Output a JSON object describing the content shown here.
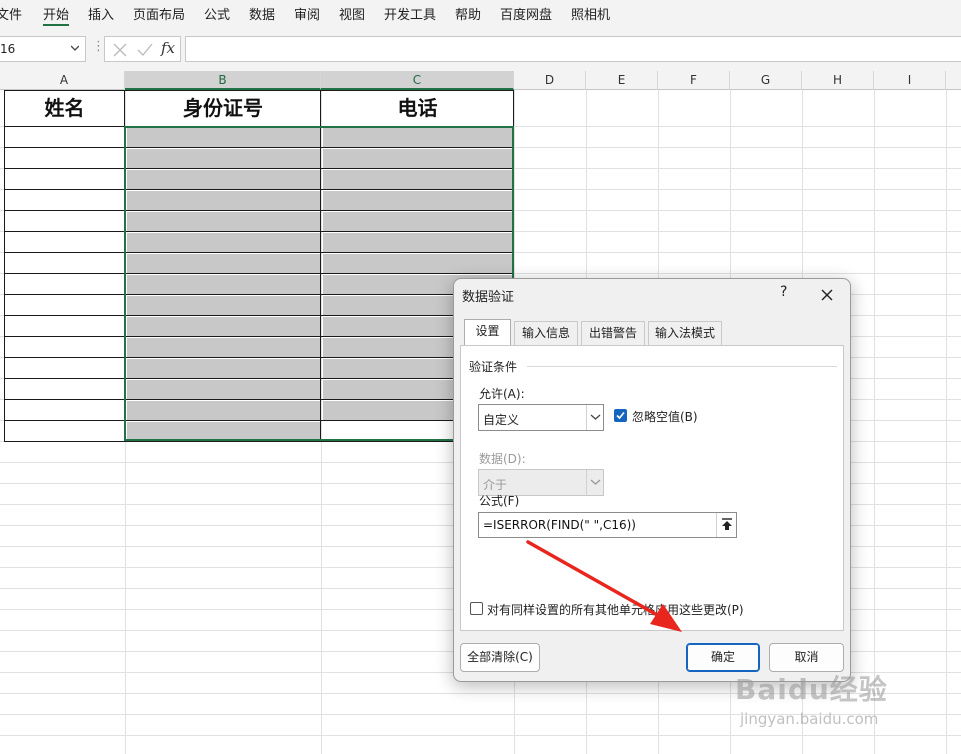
{
  "menu": [
    "文件",
    "开始",
    "插入",
    "页面布局",
    "公式",
    "数据",
    "审阅",
    "视图",
    "开发工具",
    "帮助",
    "百度网盘",
    "照相机"
  ],
  "active_menu": "开始",
  "name_box": "16",
  "formula_bar_symbols": {
    "fx": "fx"
  },
  "columns": [
    "A",
    "B",
    "C",
    "D",
    "E",
    "F",
    "G",
    "H",
    "I"
  ],
  "table": {
    "headers": [
      "姓名",
      "身份证号",
      "电话"
    ],
    "shade_color": "#c8c8c8",
    "selection_color": "#217346"
  },
  "dialog": {
    "title": "数据验证",
    "help": "?",
    "tabs": [
      "设置",
      "输入信息",
      "出错警告",
      "输入法模式"
    ],
    "active_tab": "设置",
    "group_label": "验证条件",
    "allow_label": "允许(A):",
    "allow_value": "自定义",
    "ignore_blank_label": "忽略空值(B)",
    "ignore_blank_checked": true,
    "data_label": "数据(D):",
    "data_value": "介于",
    "formula_label": "公式(F)",
    "formula_value": "=ISERROR(FIND(\" \",C16))",
    "apply_all_label": "对有同样设置的所有其他单元格应用这些更改(P)",
    "apply_all_checked": false,
    "clear_all_button": "全部清除(C)",
    "ok_button": "确定",
    "cancel_button": "取消"
  },
  "watermark": {
    "logo": "Baidu经验",
    "url": "jingyan.baidu.com"
  },
  "colors": {
    "accent": "#217346",
    "checkbox": "#1565c0",
    "arrow": "#e8261e"
  }
}
